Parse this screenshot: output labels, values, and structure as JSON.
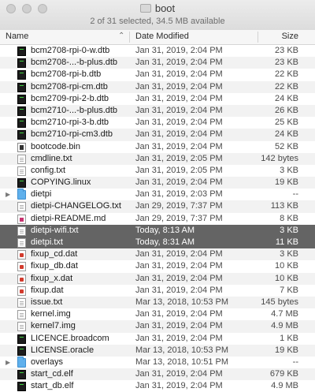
{
  "window": {
    "title": "boot",
    "status": "2 of 31 selected, 34.5 MB available"
  },
  "columns": {
    "name": "Name",
    "date": "Date Modified",
    "size": "Size"
  },
  "files": [
    {
      "name": "bcm2708-rpi-0-w.dtb",
      "date": "Jan 31, 2019, 2:04 PM",
      "size": "23 KB",
      "icon": "exec-icon"
    },
    {
      "name": "bcm2708-...-b-plus.dtb",
      "date": "Jan 31, 2019, 2:04 PM",
      "size": "23 KB",
      "icon": "exec-icon"
    },
    {
      "name": "bcm2708-rpi-b.dtb",
      "date": "Jan 31, 2019, 2:04 PM",
      "size": "22 KB",
      "icon": "exec-icon"
    },
    {
      "name": "bcm2708-rpi-cm.dtb",
      "date": "Jan 31, 2019, 2:04 PM",
      "size": "22 KB",
      "icon": "exec-icon"
    },
    {
      "name": "bcm2709-rpi-2-b.dtb",
      "date": "Jan 31, 2019, 2:04 PM",
      "size": "24 KB",
      "icon": "exec-icon"
    },
    {
      "name": "bcm2710-...-b-plus.dtb",
      "date": "Jan 31, 2019, 2:04 PM",
      "size": "26 KB",
      "icon": "exec-icon"
    },
    {
      "name": "bcm2710-rpi-3-b.dtb",
      "date": "Jan 31, 2019, 2:04 PM",
      "size": "25 KB",
      "icon": "exec-icon"
    },
    {
      "name": "bcm2710-rpi-cm3.dtb",
      "date": "Jan 31, 2019, 2:04 PM",
      "size": "24 KB",
      "icon": "exec-icon"
    },
    {
      "name": "bootcode.bin",
      "date": "Jan 31, 2019, 2:04 PM",
      "size": "52 KB",
      "icon": "binary-icon"
    },
    {
      "name": "cmdline.txt",
      "date": "Jan 31, 2019, 2:05 PM",
      "size": "142 bytes",
      "icon": "document-icon"
    },
    {
      "name": "config.txt",
      "date": "Jan 31, 2019, 2:05 PM",
      "size": "3 KB",
      "icon": "document-icon"
    },
    {
      "name": "COPYING.linux",
      "date": "Jan 31, 2019, 2:04 PM",
      "size": "19 KB",
      "icon": "exec-icon"
    },
    {
      "name": "dietpi",
      "date": "Jan 31, 2019, 2:03 PM",
      "size": "--",
      "icon": "folder-icon",
      "folder": true
    },
    {
      "name": "dietpi-CHANGELOG.txt",
      "date": "Jan 29, 2019, 7:37 PM",
      "size": "113 KB",
      "icon": "document-icon"
    },
    {
      "name": "dietpi-README.md",
      "date": "Jan 29, 2019, 7:37 PM",
      "size": "8 KB",
      "icon": "markdown-icon"
    },
    {
      "name": "dietpi-wifi.txt",
      "date": "Today, 8:13 AM",
      "size": "3 KB",
      "icon": "document-icon",
      "selected": true
    },
    {
      "name": "dietpi.txt",
      "date": "Today, 8:31 AM",
      "size": "11 KB",
      "icon": "document-icon",
      "selected": true
    },
    {
      "name": "fixup_cd.dat",
      "date": "Jan 31, 2019, 2:04 PM",
      "size": "3 KB",
      "icon": "pdf-icon"
    },
    {
      "name": "fixup_db.dat",
      "date": "Jan 31, 2019, 2:04 PM",
      "size": "10 KB",
      "icon": "pdf-icon"
    },
    {
      "name": "fixup_x.dat",
      "date": "Jan 31, 2019, 2:04 PM",
      "size": "10 KB",
      "icon": "pdf-icon"
    },
    {
      "name": "fixup.dat",
      "date": "Jan 31, 2019, 2:04 PM",
      "size": "7 KB",
      "icon": "pdf-icon"
    },
    {
      "name": "issue.txt",
      "date": "Mar 13, 2018, 10:53 PM",
      "size": "145 bytes",
      "icon": "document-icon"
    },
    {
      "name": "kernel.img",
      "date": "Jan 31, 2019, 2:04 PM",
      "size": "4.7 MB",
      "icon": "document-icon"
    },
    {
      "name": "kernel7.img",
      "date": "Jan 31, 2019, 2:04 PM",
      "size": "4.9 MB",
      "icon": "document-icon"
    },
    {
      "name": "LICENCE.broadcom",
      "date": "Jan 31, 2019, 2:04 PM",
      "size": "1 KB",
      "icon": "exec-icon"
    },
    {
      "name": "LICENSE.oracle",
      "date": "Mar 13, 2018, 10:53 PM",
      "size": "19 KB",
      "icon": "exec-icon"
    },
    {
      "name": "overlays",
      "date": "Mar 13, 2018, 10:51 PM",
      "size": "--",
      "icon": "folder-icon",
      "folder": true
    },
    {
      "name": "start_cd.elf",
      "date": "Jan 31, 2019, 2:04 PM",
      "size": "679 KB",
      "icon": "exec-icon"
    },
    {
      "name": "start_db.elf",
      "date": "Jan 31, 2019, 2:04 PM",
      "size": "4.9 MB",
      "icon": "exec-icon"
    }
  ]
}
